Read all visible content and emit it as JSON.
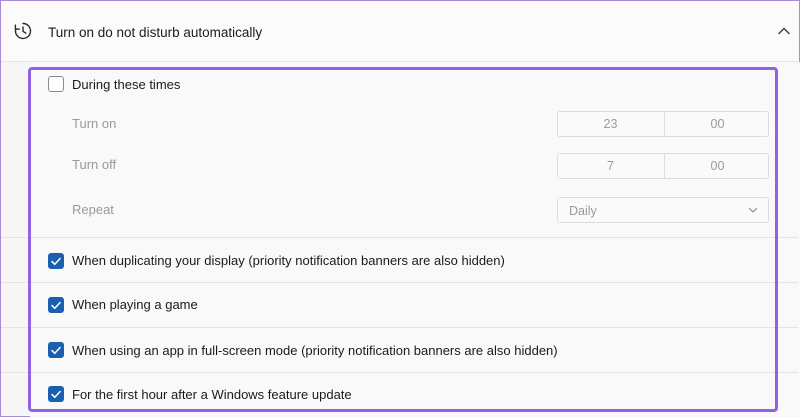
{
  "header": {
    "title": "Turn on do not disturb automatically",
    "icon": "clock-icon",
    "expand_icon": "chevron-up-icon"
  },
  "during_times": {
    "label": "During these times",
    "checked": false,
    "turn_on": {
      "label": "Turn on",
      "hour": "23",
      "minute": "00"
    },
    "turn_off": {
      "label": "Turn off",
      "hour": "7",
      "minute": "00"
    },
    "repeat": {
      "label": "Repeat",
      "value": "Daily"
    }
  },
  "options": [
    {
      "label": "When duplicating your display (priority notification banners are also hidden)",
      "checked": true
    },
    {
      "label": "When playing a game",
      "checked": true
    },
    {
      "label": "When using an app in full-screen mode (priority notification banners are also hidden)",
      "checked": true
    },
    {
      "label": "For the first hour after a Windows feature update",
      "checked": true
    }
  ],
  "colors": {
    "accent": "#1b5fb1",
    "highlight": "#8f63e4"
  }
}
